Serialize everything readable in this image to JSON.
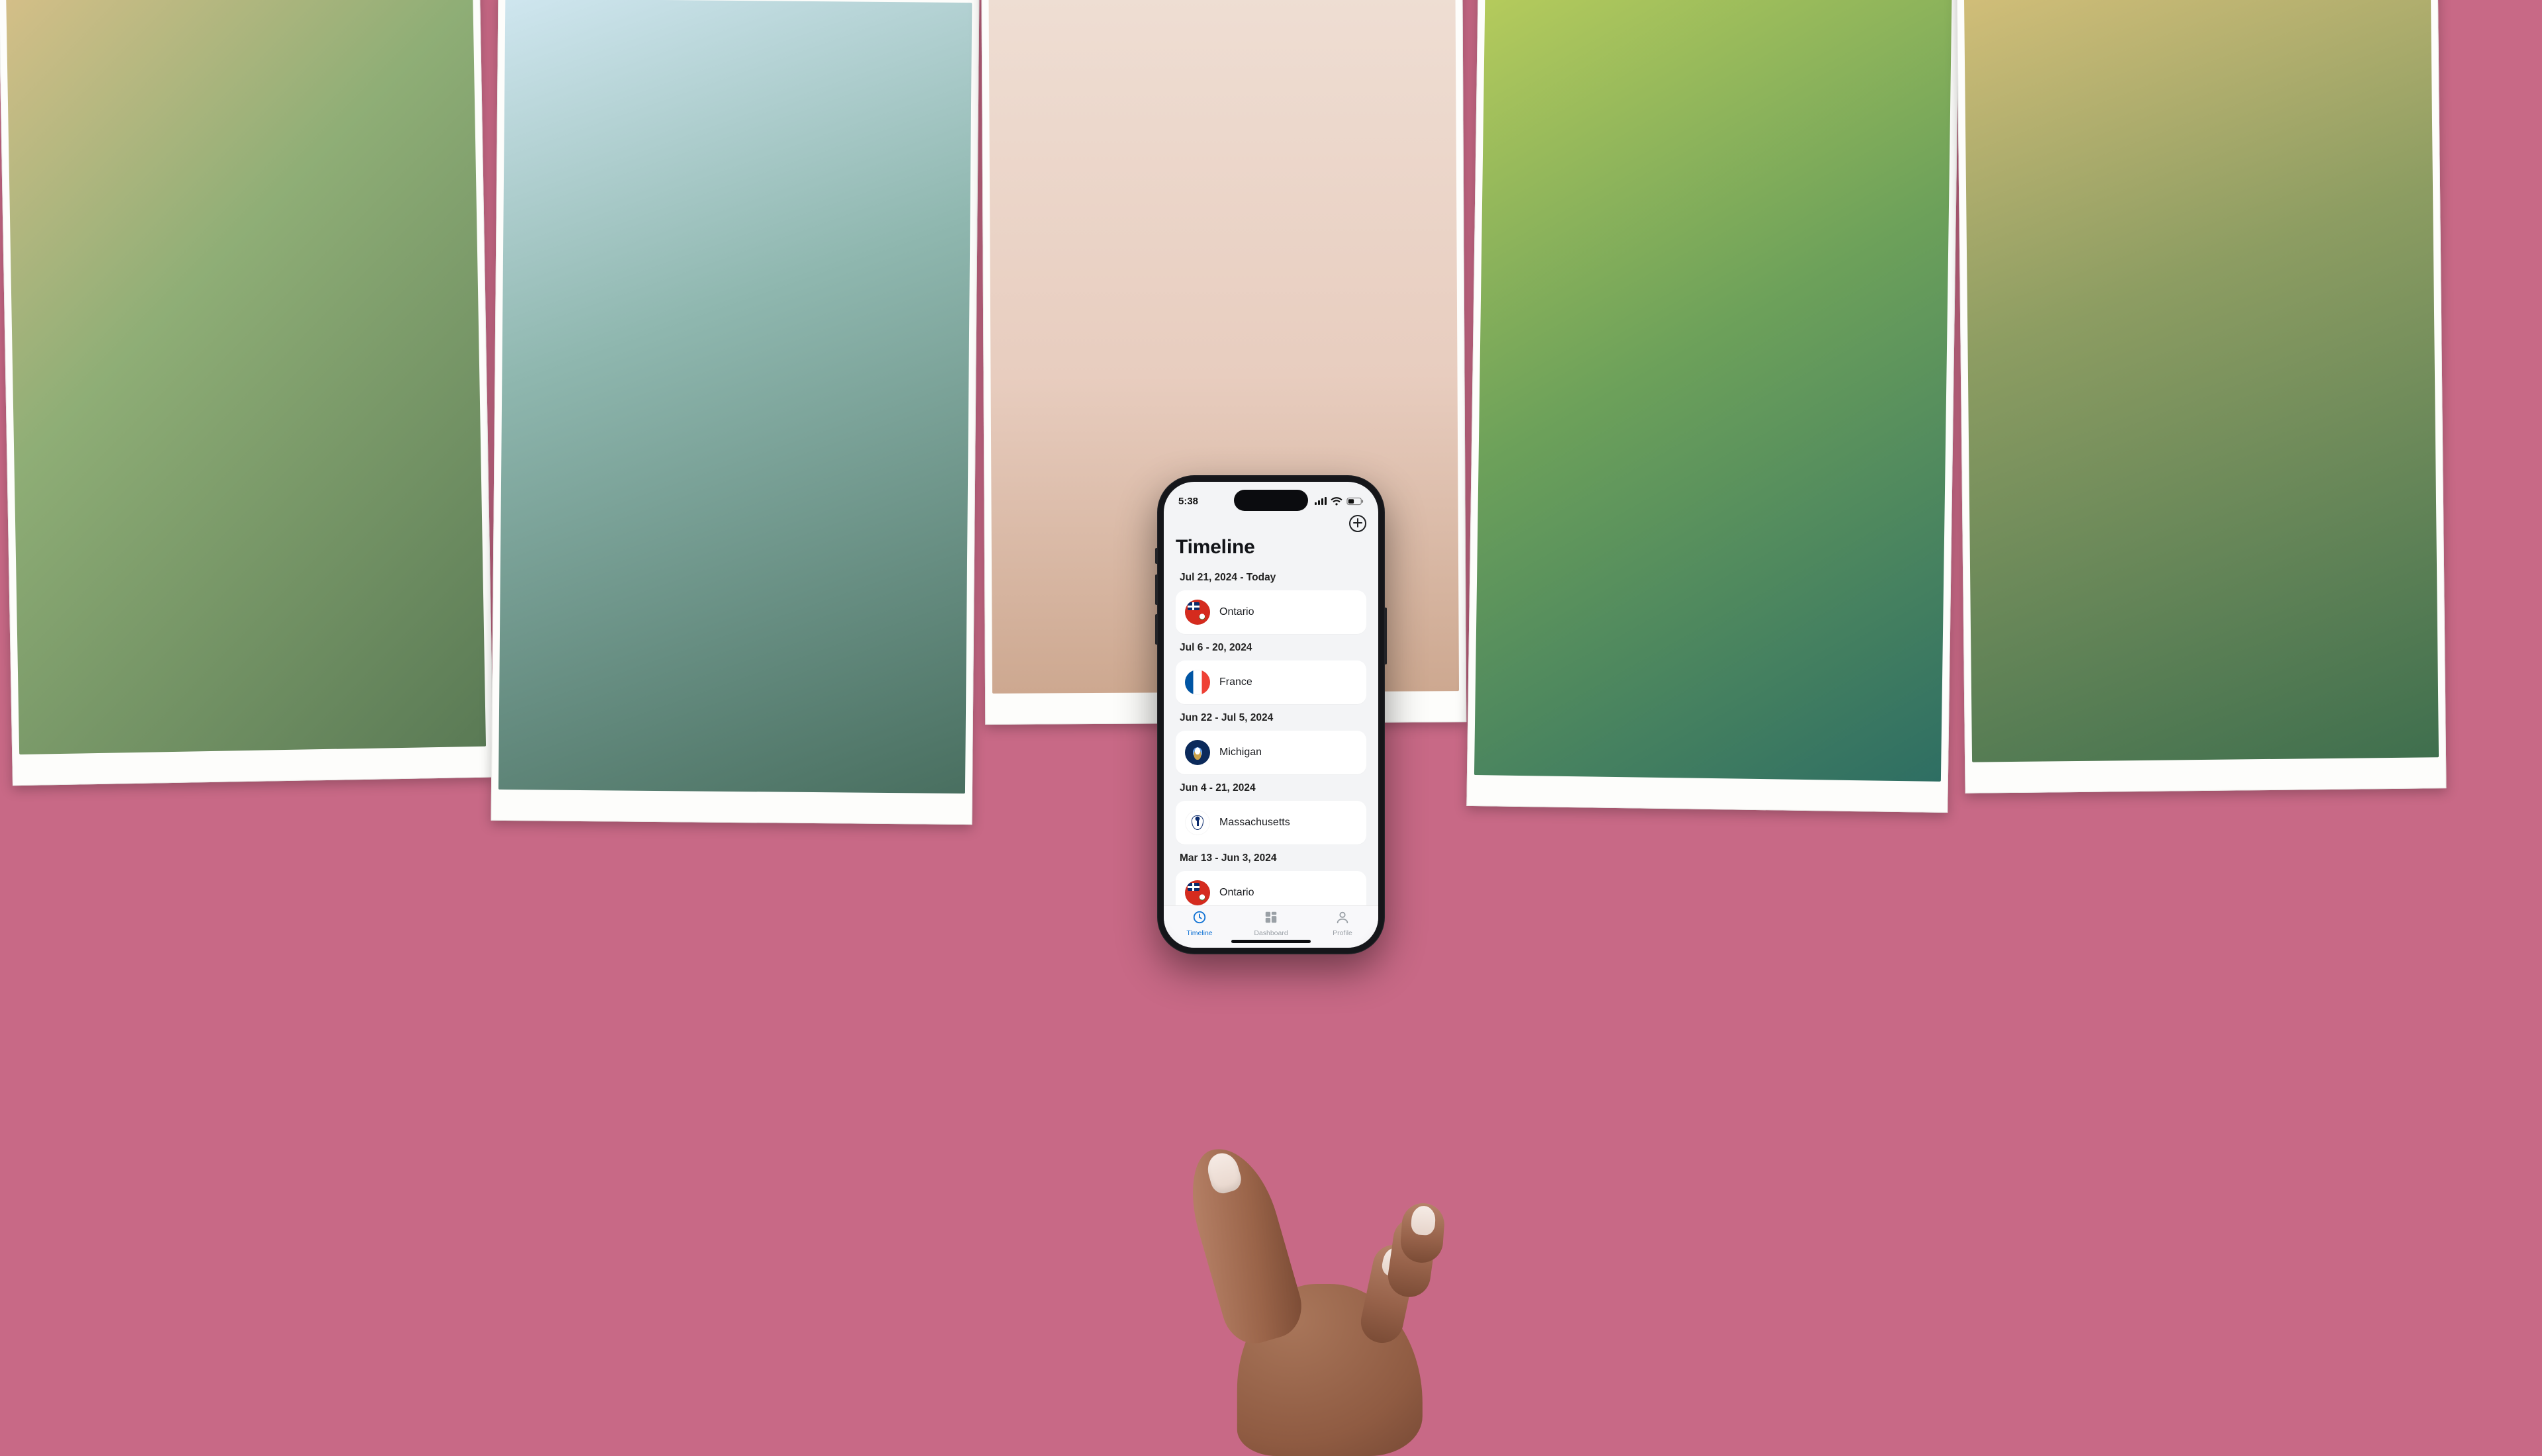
{
  "status": {
    "time": "5:38"
  },
  "header": {
    "title": "Timeline"
  },
  "timeline": [
    {
      "date_range": "Jul 21, 2024 - Today",
      "place": "Ontario",
      "flag": "ontario"
    },
    {
      "date_range": "Jul 6 - 20, 2024",
      "place": "France",
      "flag": "france"
    },
    {
      "date_range": "Jun 22 - Jul 5, 2024",
      "place": "Michigan",
      "flag": "michigan"
    },
    {
      "date_range": "Jun 4 - 21, 2024",
      "place": "Massachusetts",
      "flag": "mass"
    },
    {
      "date_range": "Mar 13 - Jun 3, 2024",
      "place": "Ontario",
      "flag": "ontario"
    }
  ],
  "tabs": {
    "timeline": "Timeline",
    "dashboard": "Dashboard",
    "profile": "Profile"
  },
  "colors": {
    "background": "#c86986",
    "accent": "#1173d4",
    "card": "#ffffff",
    "screen": "#f3f4f6"
  }
}
